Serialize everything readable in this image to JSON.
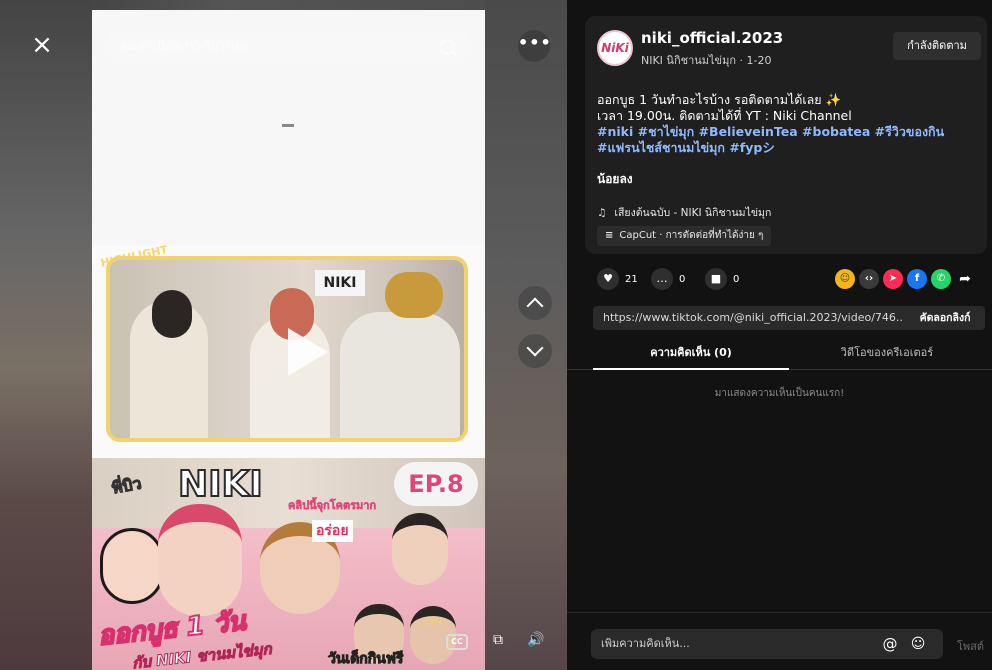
{
  "search": {
    "placeholder": "ค้นหาเนื้อหาที่เกี่ยวข้อง"
  },
  "video": {
    "highlight_tag": "HIGHLIGHT",
    "sign_text": "NIKI",
    "ep_badge": "EP.8",
    "brand_logo": "NIKI",
    "pbiw_text": "พี่บิว",
    "clip_tag": "คลิปนี้จุกโคตรมาก",
    "yummy_text": "อร่อย",
    "title_main": "ออกบูธ 1 วัน",
    "title_sub": "กับ NIKI ชานมไข่มุก",
    "title_bottom": "วันเด็กกินฟรี",
    "deco_text": "ฟรี!!"
  },
  "controls": {
    "close_icon": "×",
    "more_icon": "•••",
    "cc_label": "CC",
    "pip_icon": "⧉",
    "volume_icon": "🔊"
  },
  "profile": {
    "avatar_text": "NiKi",
    "username": "niki_official.2023",
    "subname": "NIKI นิกิชานมไข่มุก · 1-20",
    "follow_label": "กำลังติดตาม"
  },
  "caption": {
    "line1": "ออกบูธ 1 วันทำอะไรบ้าง รอติดตามได้เลย ✨",
    "line2": "เวลา 19.00น. ติดตามได้ที่ YT : Niki Channel",
    "hashtags_line1": "#niki #ชาไข่มุก #BelieveinTea #bobatea #รีวิวของกิน",
    "hashtags_line2": "#แฟรนไชส์ชานมไข่มุก #fypシ",
    "less_label": "น้อยลง",
    "music": "เสียงต้นฉบับ - NIKI นิกิชานมไข่มุก",
    "music_icon": "♫",
    "capcut": "CapCut · การตัดต่อที่ทำได้ง่าย ๆ",
    "capcut_icon": "≡"
  },
  "stats": {
    "likes": "21",
    "comments": "0",
    "saves": "0",
    "like_icon": "♥",
    "comment_icon": "…",
    "save_icon": "■"
  },
  "share": {
    "icons": [
      "☺",
      "‹›",
      "➤",
      "f",
      "✆",
      "➦"
    ]
  },
  "link": {
    "url": "https://www.tiktok.com/@niki_official.2023/video/746...",
    "copy_label": "คัดลอกลิงก์"
  },
  "tabs": {
    "comments": "ความคิดเห็น (0)",
    "creator_videos": "วิดีโอของครีเอเตอร์"
  },
  "comments": {
    "empty_message": "มาแสดงความเห็นเป็นคนแรก!",
    "input_placeholder": "เพิ่มความคิดเห็น...",
    "at_icon": "@",
    "emoji_icon": "☺",
    "post_label": "โพสต์"
  }
}
